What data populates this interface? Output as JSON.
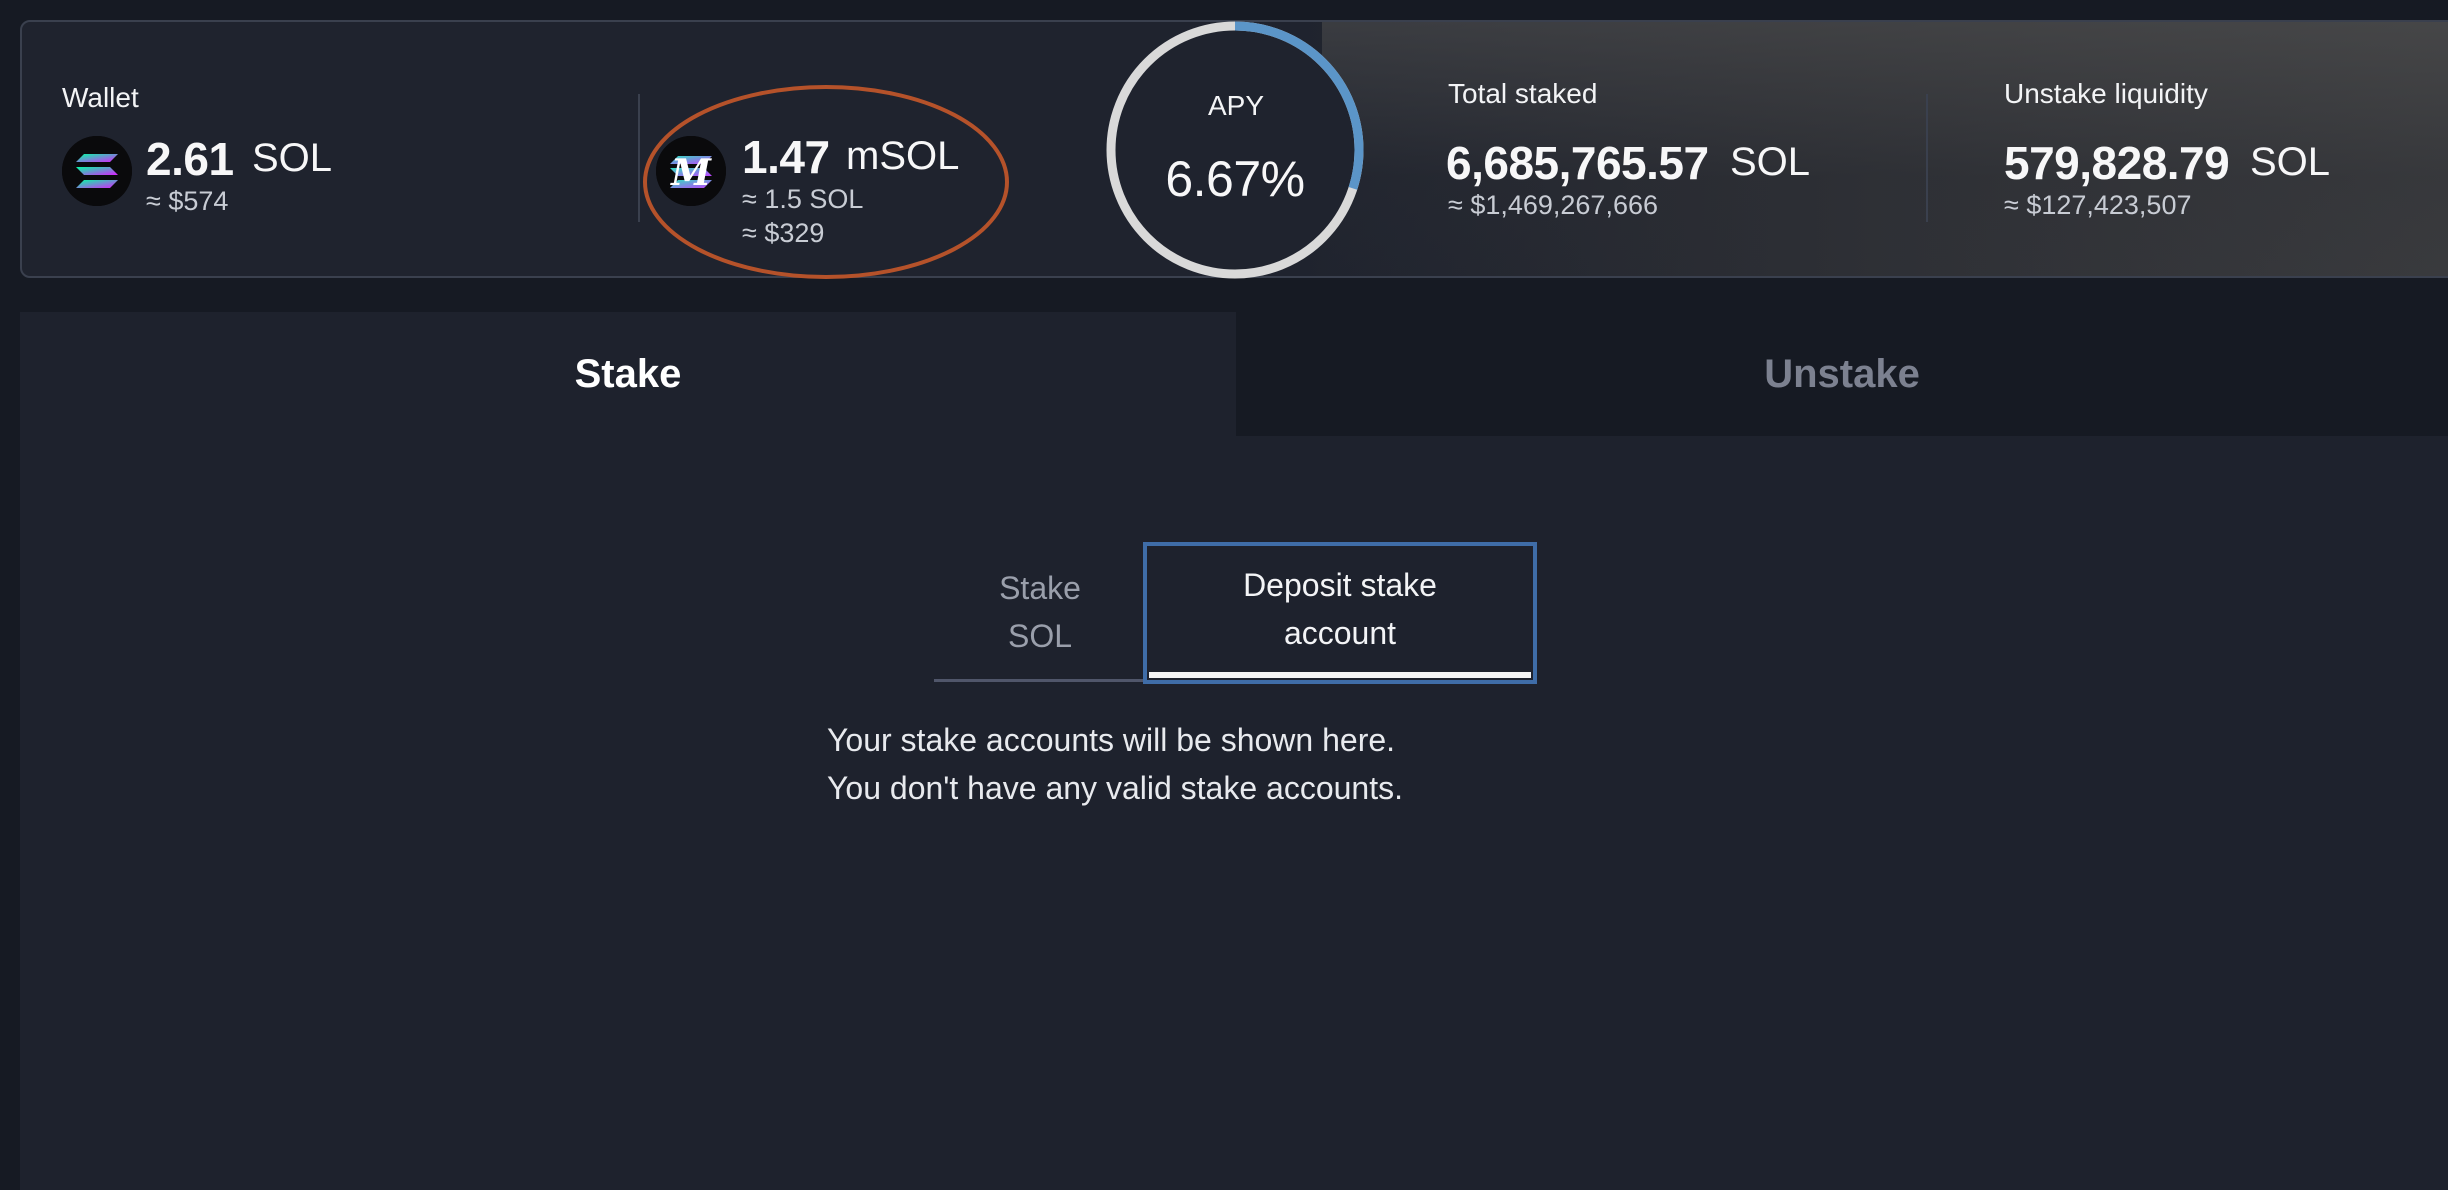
{
  "wallet": {
    "label": "Wallet",
    "amount": "2.61",
    "unit": "SOL",
    "usd": "≈ $574",
    "icon": "solana-icon"
  },
  "msol": {
    "amount": "1.47",
    "unit": "mSOL",
    "sol_equiv": "≈ 1.5 SOL",
    "usd": "≈ $329",
    "icon": "marinade-msol-icon"
  },
  "apy": {
    "label": "APY",
    "value": "6.67%",
    "progress": 0.3
  },
  "total_staked": {
    "label": "Total staked",
    "amount": "6,685,765.57",
    "unit": "SOL",
    "usd": "≈ $1,469,267,666"
  },
  "unstake_liquidity": {
    "label": "Unstake liquidity",
    "amount": "579,828.79",
    "unit": "SOL",
    "usd": "≈ $127,423,507"
  },
  "tabs": {
    "stake": "Stake",
    "unstake": "Unstake",
    "active": "stake"
  },
  "subtabs": {
    "stake_sol": "Stake\nSOL",
    "deposit_stake_account": "Deposit stake\naccount",
    "active": "deposit_stake_account"
  },
  "message": {
    "line1": "Your stake accounts will be shown here.",
    "line2": "You don't have any valid stake accounts."
  },
  "colors": {
    "background": "#161a23",
    "panel": "#1e222d",
    "ring_track": "#d9d9d9",
    "ring_progress": "#5b95c8",
    "focus_border": "#3f6da8",
    "annotation": "#b5522a"
  }
}
